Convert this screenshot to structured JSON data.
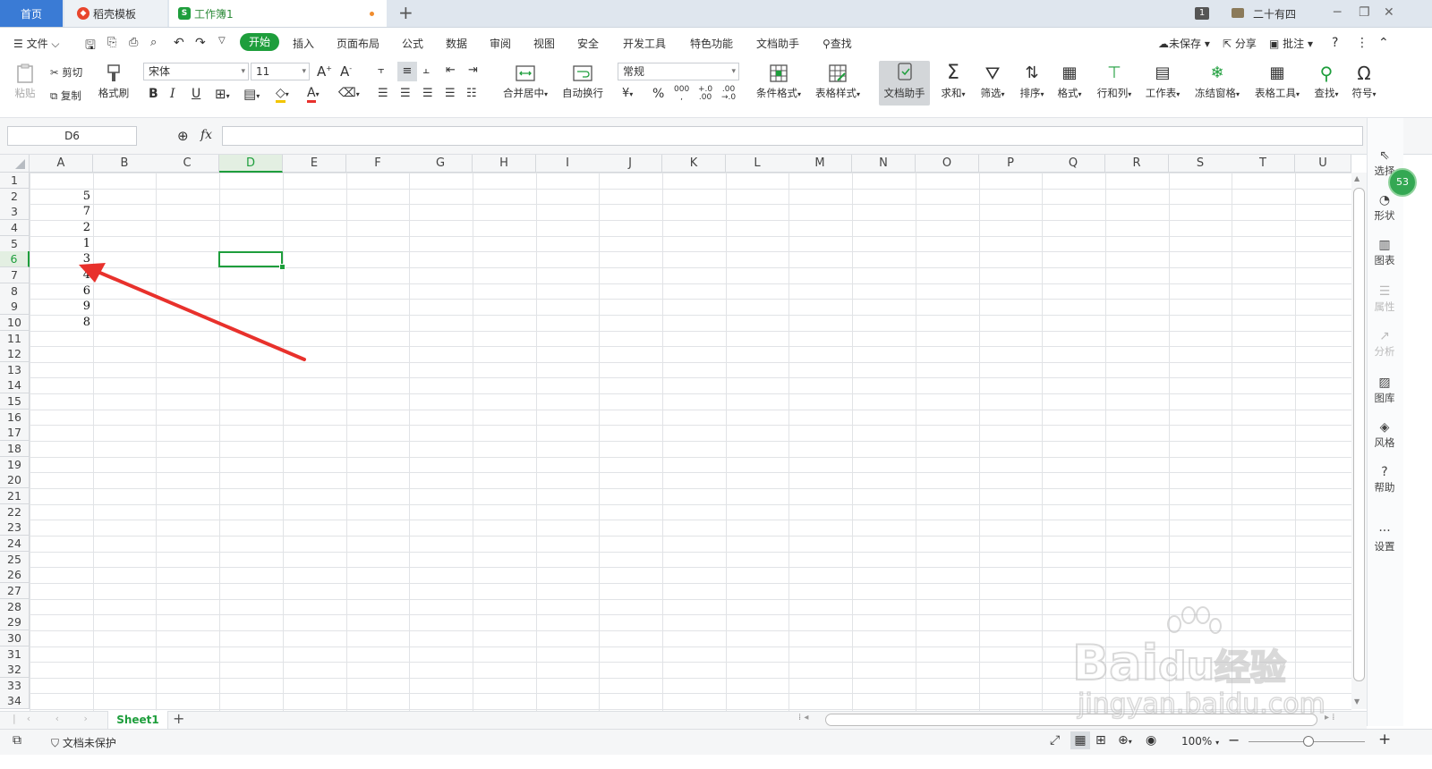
{
  "titlebar": {
    "tabs": [
      {
        "label": "首页"
      },
      {
        "label": "稻壳模板"
      },
      {
        "label": "工作簿1"
      }
    ],
    "new_tab": "+",
    "badge": "1",
    "user": "二十有四"
  },
  "menu": {
    "file": "文件",
    "items": [
      "开始",
      "插入",
      "页面布局",
      "公式",
      "数据",
      "审阅",
      "视图",
      "安全",
      "开发工具",
      "特色功能",
      "文档助手"
    ],
    "search": "查找",
    "unsaved": "未保存",
    "share": "分享",
    "comment": "批注"
  },
  "ribbon": {
    "paste": "粘贴",
    "cut": "剪切",
    "copy": "复制",
    "format_painter": "格式刷",
    "font_name": "宋体",
    "font_size": "11",
    "merge_center": "合并居中",
    "wrap_text": "自动换行",
    "number_format": "常规",
    "conditional_format": "条件格式",
    "table_style": "表格样式",
    "doc_assistant": "文档助手",
    "sum": "求和",
    "filter": "筛选",
    "sort": "排序",
    "format": "格式",
    "row_col": "行和列",
    "worksheet": "工作表",
    "freeze": "冻结窗格",
    "table_tools": "表格工具",
    "find": "查找",
    "symbol": "符号"
  },
  "formula_bar": {
    "name_box": "D6",
    "fx": "fx",
    "formula": ""
  },
  "grid": {
    "columns": [
      "A",
      "B",
      "C",
      "D",
      "E",
      "F",
      "G",
      "H",
      "I",
      "J",
      "K",
      "L",
      "M",
      "N",
      "O",
      "P",
      "Q",
      "R",
      "S",
      "T",
      "U"
    ],
    "selected_column": "D",
    "selected_row": "6",
    "row_count": 34,
    "column_a_values": [
      {
        "row": 2,
        "value": "5"
      },
      {
        "row": 3,
        "value": "7"
      },
      {
        "row": 4,
        "value": "2"
      },
      {
        "row": 5,
        "value": "1"
      },
      {
        "row": 6,
        "value": "3"
      },
      {
        "row": 7,
        "value": "4"
      },
      {
        "row": 8,
        "value": "6"
      },
      {
        "row": 9,
        "value": "9"
      },
      {
        "row": 10,
        "value": "8"
      }
    ]
  },
  "right_panel": {
    "items": [
      "选择",
      "形状",
      "图表",
      "属性",
      "分析",
      "图库",
      "风格",
      "帮助",
      "设置"
    ],
    "badge": "53"
  },
  "sheets": {
    "tabs": [
      "Sheet1"
    ],
    "add": "+"
  },
  "status": {
    "protect": "文档未保护",
    "zoom": "100%"
  },
  "colors": {
    "accent_green": "#1e9e3c",
    "annotation_red": "#e8312c",
    "home_tab_blue": "#3a7bd5"
  },
  "watermark": {
    "brand": "Bai",
    "brand2": "du",
    "brand_cn": "经验",
    "url": "jingyan.baidu.com"
  }
}
